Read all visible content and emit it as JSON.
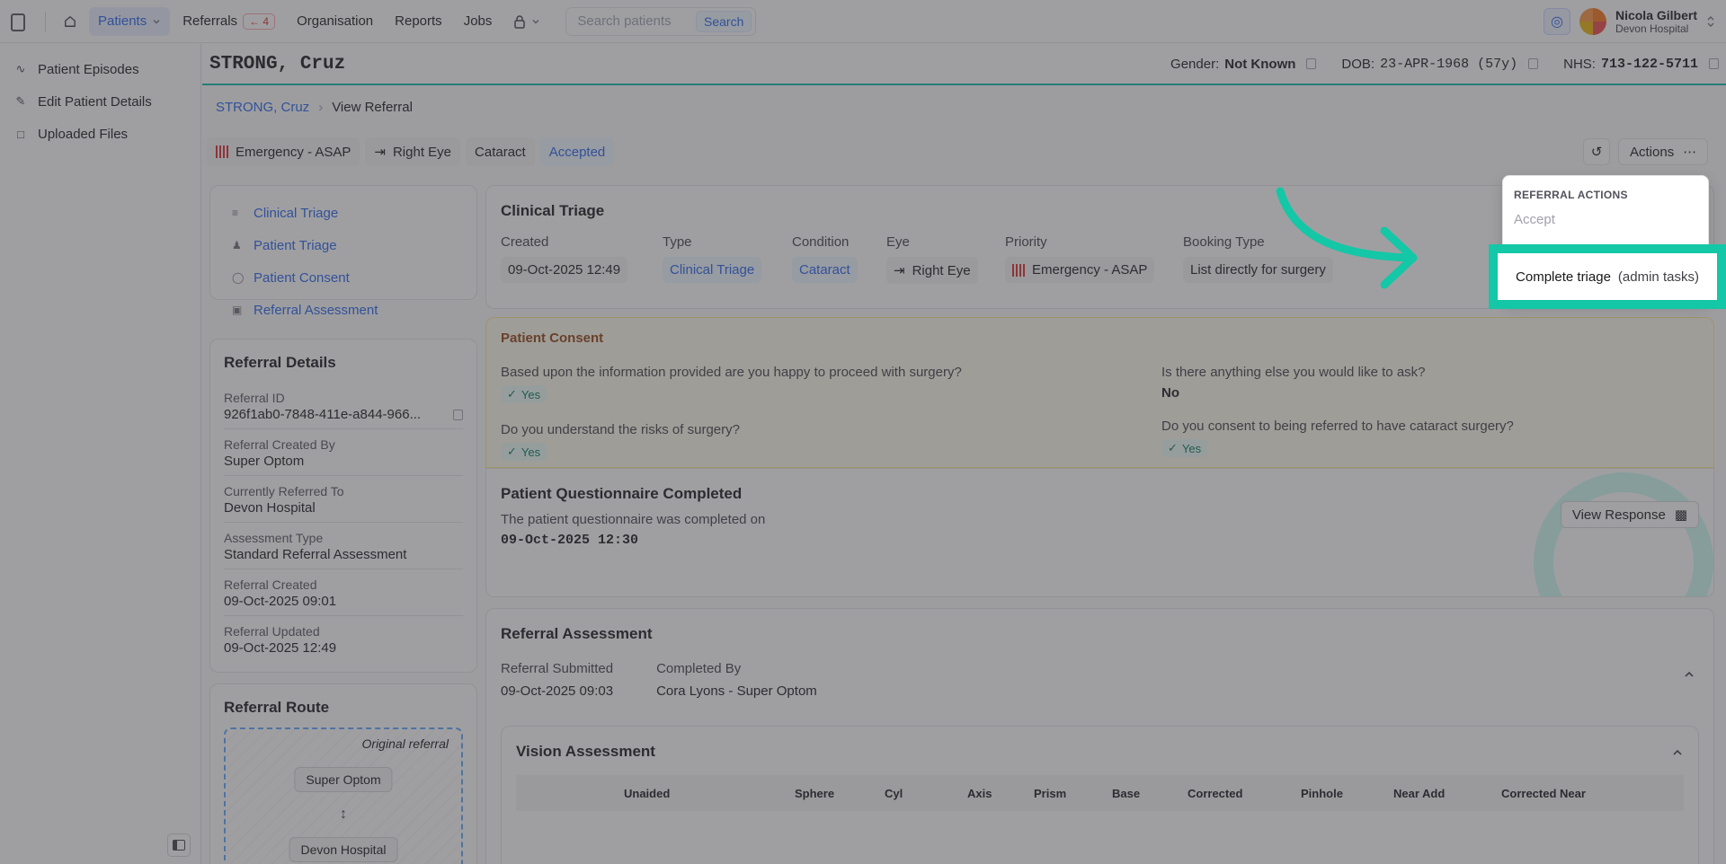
{
  "nav": {
    "patients": "Patients",
    "referrals": "Referrals",
    "referrals_badge": "4",
    "organisation": "Organisation",
    "reports": "Reports",
    "jobs": "Jobs",
    "search_placeholder": "Search patients",
    "search_button": "Search"
  },
  "user": {
    "name": "Nicola Gilbert",
    "org": "Devon Hospital"
  },
  "sidebar": {
    "items": [
      {
        "label": "Patient Episodes",
        "icon": "activity-icon"
      },
      {
        "label": "Edit Patient Details",
        "icon": "pencil-icon"
      },
      {
        "label": "Uploaded Files",
        "icon": "file-icon"
      }
    ]
  },
  "patient": {
    "name": "STRONG, Cruz",
    "gender_label": "Gender:",
    "gender": "Not Known",
    "dob_label": "DOB:",
    "dob": "23-APR-1968 (57y)",
    "nhs_label": "NHS:",
    "nhs": "713-122-5711"
  },
  "breadcrumb": {
    "surname": "STRONG,",
    "forename": "Cruz",
    "current": "View Referral"
  },
  "tags": {
    "priority": "Emergency - ASAP",
    "eye": "Right Eye",
    "condition": "Cataract",
    "status": "Accepted"
  },
  "actions_label": "Actions",
  "toc": [
    "Clinical Triage",
    "Patient Triage",
    "Patient Consent",
    "Referral Assessment"
  ],
  "referral_details": {
    "title": "Referral Details",
    "fields": [
      {
        "label": "Referral ID",
        "value": "926f1ab0-7848-411e-a844-966..."
      },
      {
        "label": "Referral Created By",
        "value": "Super Optom"
      },
      {
        "label": "Currently Referred To",
        "value": "Devon Hospital"
      },
      {
        "label": "Assessment Type",
        "value": "Standard Referral Assessment"
      },
      {
        "label": "Referral Created",
        "value": "09-Oct-2025 09:01"
      },
      {
        "label": "Referral Updated",
        "value": "09-Oct-2025 12:49"
      }
    ]
  },
  "referral_route": {
    "title": "Referral Route",
    "label": "Original referral",
    "from": "Super Optom",
    "to": "Devon Hospital"
  },
  "clinical_triage": {
    "title": "Clinical Triage",
    "columns": [
      {
        "label": "Created",
        "value": "09-Oct-2025 12:49"
      },
      {
        "label": "Type",
        "value": "Clinical Triage"
      },
      {
        "label": "Condition",
        "value": "Cataract"
      },
      {
        "label": "Eye",
        "value": "Right Eye"
      },
      {
        "label": "Priority",
        "value": "Emergency - ASAP"
      },
      {
        "label": "Booking Type",
        "value": "List directly for surgery"
      }
    ]
  },
  "consent": {
    "title": "Patient Consent",
    "q1": "Based upon the information provided are you happy to proceed with surgery?",
    "a1": "Yes",
    "q2": "Do you understand the risks of surgery?",
    "a2": "Yes",
    "q3": "Is there anything else you would like to ask?",
    "a3": "No",
    "q4": "Do you consent to being referred to have cataract surgery?",
    "a4": "Yes"
  },
  "questionnaire": {
    "title": "Patient Questionnaire Completed",
    "subtitle": "The patient questionnaire was completed on",
    "date": "09-Oct-2025 12:30",
    "button": "View Response"
  },
  "assessment": {
    "title": "Referral Assessment",
    "submitted_label": "Referral Submitted",
    "submitted": "09-Oct-2025 09:03",
    "completed_label": "Completed By",
    "completed": "Cora Lyons - Super Optom",
    "vision_title": "Vision Assessment",
    "columns": [
      "Unaided",
      "Sphere",
      "Cyl",
      "Axis",
      "Prism",
      "Base",
      "Corrected",
      "Pinhole",
      "Near Add",
      "Corrected Near"
    ]
  },
  "dropdown": {
    "header": "REFERRAL ACTIONS",
    "accept": "Accept",
    "complete": "Complete triage",
    "complete_note": "(admin tasks)"
  },
  "colors": {
    "accent": "#2563eb",
    "highlight": "#14c7a6",
    "teal": "#14b8a6"
  }
}
